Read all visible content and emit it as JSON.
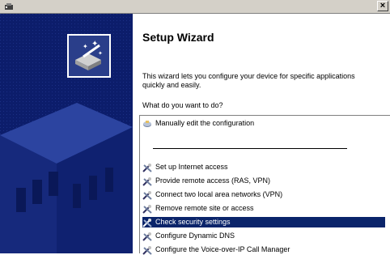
{
  "window": {
    "close_label": "×"
  },
  "wizard": {
    "title": "Setup Wizard",
    "description": "This wizard lets you configure your device for specific applications quickly and easily.",
    "question": "What do you want to do?"
  },
  "options": [
    {
      "label": "Manually edit the configuration",
      "icon": "edit-config-icon",
      "selected": false
    },
    {
      "label": "Set up Internet access",
      "icon": "tools-icon",
      "selected": false
    },
    {
      "label": "Provide remote access (RAS, VPN)",
      "icon": "tools-icon",
      "selected": false
    },
    {
      "label": "Connect two local area networks (VPN)",
      "icon": "tools-icon",
      "selected": false
    },
    {
      "label": "Remove remote site or access",
      "icon": "tools-icon",
      "selected": false
    },
    {
      "label": "Check security settings",
      "icon": "tools-icon",
      "selected": true
    },
    {
      "label": "Configure Dynamic DNS",
      "icon": "tools-icon",
      "selected": false
    },
    {
      "label": "Configure the Voice-over-IP Call Manager",
      "icon": "tools-icon",
      "selected": false
    }
  ],
  "colors": {
    "selection": "#0a246a",
    "panel": "#0c1d6b"
  }
}
